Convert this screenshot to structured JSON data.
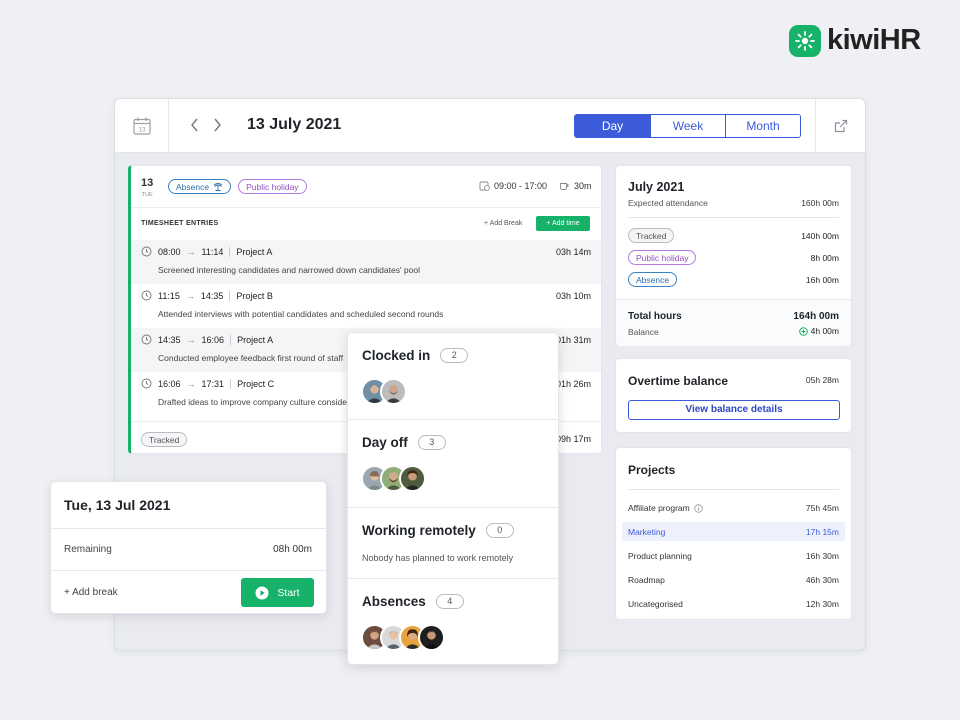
{
  "brand": {
    "name": "kiwiHR",
    "color": "#17b26a"
  },
  "topbar": {
    "date": "13 July 2021",
    "views": [
      {
        "label": "Day",
        "active": true
      },
      {
        "label": "Week",
        "active": false
      },
      {
        "label": "Month",
        "active": false
      }
    ],
    "calendar_day": "13"
  },
  "timesheet": {
    "day_number": "13",
    "day_short": "TUE",
    "tags": {
      "absence": "Absence",
      "holiday": "Public holiday"
    },
    "hours": "09:00 - 17:00",
    "break": "30m",
    "section_title": "TIMESHEET ENTRIES",
    "add_break": "+ Add Break",
    "add_time": "+ Add time",
    "entries": [
      {
        "start": "08:00",
        "end": "11:14",
        "project": "Project A",
        "duration": "03h 14m",
        "description": "Screened interesting candidates and narrowed down candidates' pool"
      },
      {
        "start": "11:15",
        "end": "14:35",
        "project": "Project B",
        "duration": "03h 10m",
        "description": "Attended interviews with potential candidates and scheduled second rounds"
      },
      {
        "start": "14:35",
        "end": "16:06",
        "project": "Project A",
        "duration": "01h 31m",
        "description": "Conducted employee feedback first round of staff"
      },
      {
        "start": "16:06",
        "end": "17:31",
        "project": "Project C",
        "duration": "01h 26m",
        "description": "Drafted ideas to improve company culture conside"
      }
    ],
    "footer_tag": "Tracked",
    "footer_total": "09h 17m"
  },
  "month": {
    "title": "July 2021",
    "expected_label": "Expected attendance",
    "expected_value": "160h 00m",
    "rows": [
      {
        "label": "Tracked",
        "value": "140h 00m"
      },
      {
        "label": "Public holiday",
        "value": "8h 00m"
      },
      {
        "label": "Absence",
        "value": "16h 00m"
      }
    ],
    "total_label": "Total hours",
    "total_value": "164h 00m",
    "balance_label": "Balance",
    "balance_value": "4h 00m"
  },
  "overtime": {
    "title": "Overtime balance",
    "value": "05h 28m",
    "button": "View balance details"
  },
  "projects": {
    "title": "Projects",
    "items": [
      {
        "name": "Affiliate program",
        "value": "75h 45m",
        "info": true,
        "active": false
      },
      {
        "name": "Marketing",
        "value": "17h 15m",
        "info": false,
        "active": true
      },
      {
        "name": "Product planning",
        "value": "16h 30m",
        "info": false,
        "active": false
      },
      {
        "name": "Roadmap",
        "value": "46h 30m",
        "info": false,
        "active": false
      },
      {
        "name": "Uncategorised",
        "value": "12h 30m",
        "info": false,
        "active": false
      }
    ]
  },
  "day_widget": {
    "title": "Tue, 13 Jul 2021",
    "remaining_label": "Remaining",
    "remaining_value": "08h 00m",
    "add_break": "+ Add break",
    "start": "Start"
  },
  "status": {
    "clocked_in": {
      "title": "Clocked in",
      "count": "2"
    },
    "day_off": {
      "title": "Day off",
      "count": "3"
    },
    "remote": {
      "title": "Working remotely",
      "count": "0",
      "empty": "Nobody has planned to work remotely"
    },
    "absences": {
      "title": "Absences",
      "count": "4"
    }
  },
  "colors": {
    "accent": "#3b5bdb",
    "green": "#17b26a",
    "holiday": "#8e4fc1",
    "absence": "#2f6fb0"
  }
}
